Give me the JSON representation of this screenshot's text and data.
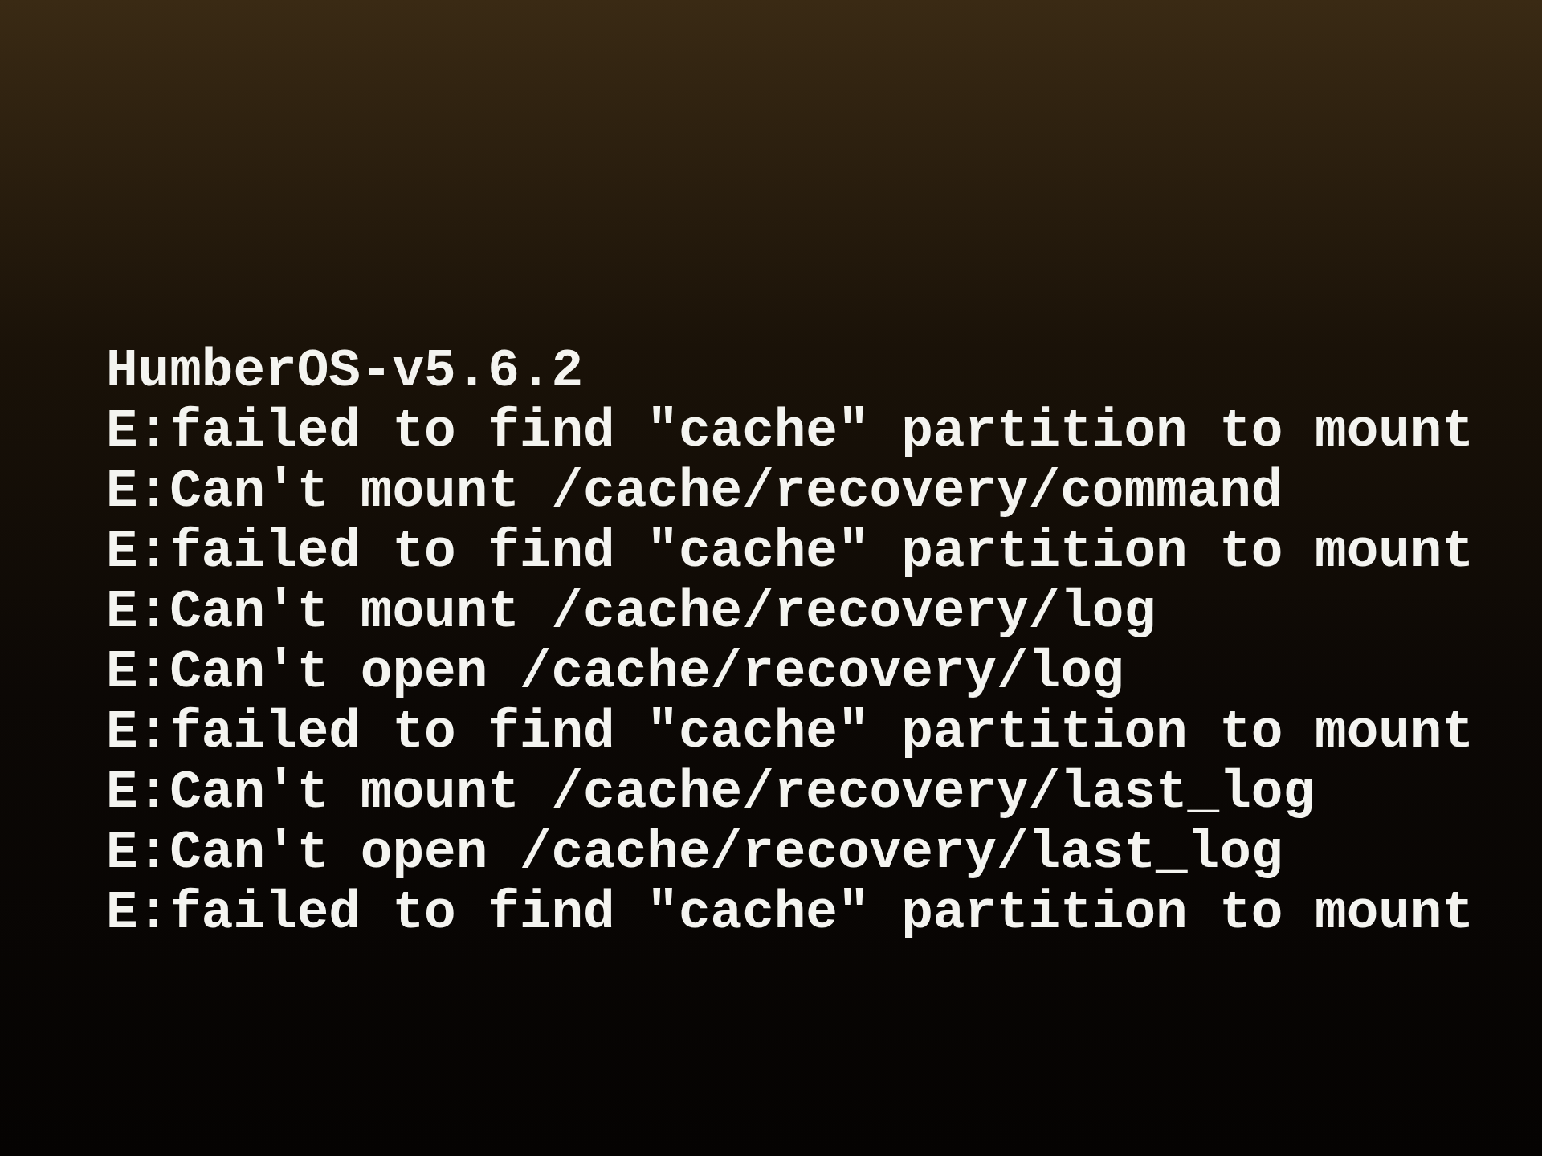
{
  "console": {
    "lines": [
      "HumberOS-v5.6.2",
      "E:failed to find \"cache\" partition to mount",
      "E:Can't mount /cache/recovery/command",
      "E:failed to find \"cache\" partition to mount",
      "E:Can't mount /cache/recovery/log",
      "E:Can't open /cache/recovery/log",
      "E:failed to find \"cache\" partition to mount",
      "E:Can't mount /cache/recovery/last_log",
      "E:Can't open /cache/recovery/last_log",
      "E:failed to find \"cache\" partition to mount"
    ]
  }
}
